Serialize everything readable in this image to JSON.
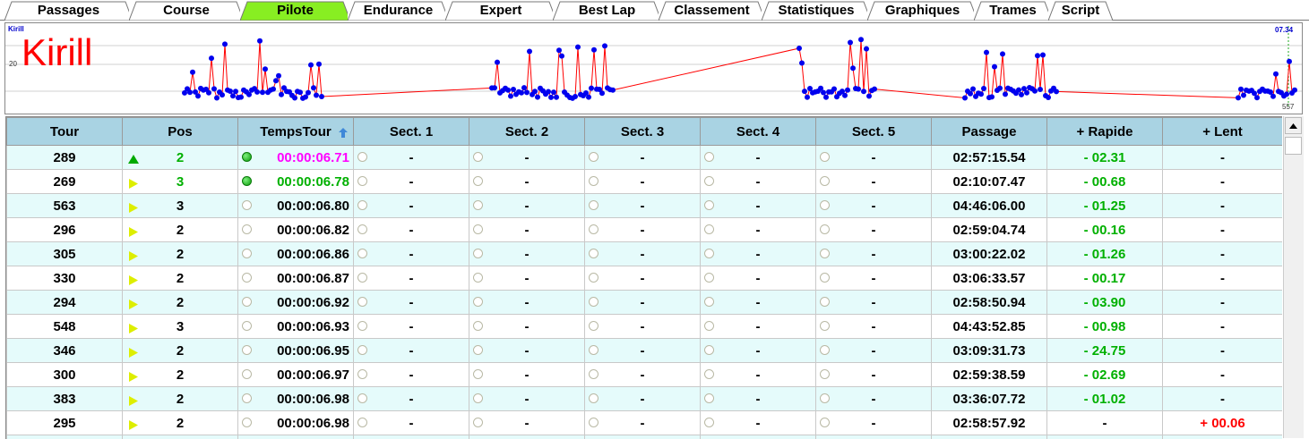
{
  "tabs": [
    {
      "label": "Passages",
      "active": false
    },
    {
      "label": "Course",
      "active": false
    },
    {
      "label": "Pilote",
      "active": true
    },
    {
      "label": "Endurance",
      "active": false
    },
    {
      "label": "Expert",
      "active": false
    },
    {
      "label": "Best Lap",
      "active": false
    },
    {
      "label": "Classement",
      "active": false
    },
    {
      "label": "Statistiques",
      "active": false
    },
    {
      "label": "Graphiques",
      "active": false
    },
    {
      "label": "Trames",
      "active": false
    },
    {
      "label": "Script",
      "active": false
    }
  ],
  "graph": {
    "pilot_small": "Kirill",
    "pilot_large": "Kirill",
    "ytick": "20",
    "top_right": "07.34",
    "bottom_right": "557"
  },
  "table": {
    "headers": [
      "Tour",
      "Pos",
      "TempsTour",
      "Sect. 1",
      "Sect. 2",
      "Sect. 3",
      "Sect. 4",
      "Sect. 5",
      "Passage",
      "+ Rapide",
      "+ Lent"
    ],
    "rows": [
      {
        "tour": "289",
        "pos_icon": "up-triangle-icon",
        "pos": "2",
        "pos_color": "green",
        "dot": "green",
        "temps": "00:00:06.71",
        "temps_color": "magenta",
        "s1": "-",
        "s2": "-",
        "s3": "-",
        "s4": "-",
        "s5": "-",
        "passage": "02:57:15.54",
        "rapide": "- 02.31",
        "rapide_color": "green",
        "lent": "-",
        "lent_color": "black"
      },
      {
        "tour": "269",
        "pos_icon": "right-triangle-icon",
        "pos": "3",
        "pos_color": "green",
        "dot": "green",
        "temps": "00:00:06.78",
        "temps_color": "green",
        "s1": "-",
        "s2": "-",
        "s3": "-",
        "s4": "-",
        "s5": "-",
        "passage": "02:10:07.47",
        "rapide": "- 00.68",
        "rapide_color": "green",
        "lent": "-",
        "lent_color": "black"
      },
      {
        "tour": "563",
        "pos_icon": "right-triangle-icon",
        "pos": "3",
        "pos_color": "black",
        "dot": "empty",
        "temps": "00:00:06.80",
        "temps_color": "black",
        "s1": "-",
        "s2": "-",
        "s3": "-",
        "s4": "-",
        "s5": "-",
        "passage": "04:46:06.00",
        "rapide": "- 01.25",
        "rapide_color": "green",
        "lent": "-",
        "lent_color": "black"
      },
      {
        "tour": "296",
        "pos_icon": "right-triangle-icon",
        "pos": "2",
        "pos_color": "black",
        "dot": "empty",
        "temps": "00:00:06.82",
        "temps_color": "black",
        "s1": "-",
        "s2": "-",
        "s3": "-",
        "s4": "-",
        "s5": "-",
        "passage": "02:59:04.74",
        "rapide": "- 00.16",
        "rapide_color": "green",
        "lent": "-",
        "lent_color": "black"
      },
      {
        "tour": "305",
        "pos_icon": "right-triangle-icon",
        "pos": "2",
        "pos_color": "black",
        "dot": "empty",
        "temps": "00:00:06.86",
        "temps_color": "black",
        "s1": "-",
        "s2": "-",
        "s3": "-",
        "s4": "-",
        "s5": "-",
        "passage": "03:00:22.02",
        "rapide": "- 01.26",
        "rapide_color": "green",
        "lent": "-",
        "lent_color": "black"
      },
      {
        "tour": "330",
        "pos_icon": "right-triangle-icon",
        "pos": "2",
        "pos_color": "black",
        "dot": "empty",
        "temps": "00:00:06.87",
        "temps_color": "black",
        "s1": "-",
        "s2": "-",
        "s3": "-",
        "s4": "-",
        "s5": "-",
        "passage": "03:06:33.57",
        "rapide": "- 00.17",
        "rapide_color": "green",
        "lent": "-",
        "lent_color": "black"
      },
      {
        "tour": "294",
        "pos_icon": "right-triangle-icon",
        "pos": "2",
        "pos_color": "black",
        "dot": "empty",
        "temps": "00:00:06.92",
        "temps_color": "black",
        "s1": "-",
        "s2": "-",
        "s3": "-",
        "s4": "-",
        "s5": "-",
        "passage": "02:58:50.94",
        "rapide": "- 03.90",
        "rapide_color": "green",
        "lent": "-",
        "lent_color": "black"
      },
      {
        "tour": "548",
        "pos_icon": "right-triangle-icon",
        "pos": "3",
        "pos_color": "black",
        "dot": "empty",
        "temps": "00:00:06.93",
        "temps_color": "black",
        "s1": "-",
        "s2": "-",
        "s3": "-",
        "s4": "-",
        "s5": "-",
        "passage": "04:43:52.85",
        "rapide": "- 00.98",
        "rapide_color": "green",
        "lent": "-",
        "lent_color": "black"
      },
      {
        "tour": "346",
        "pos_icon": "right-triangle-icon",
        "pos": "2",
        "pos_color": "black",
        "dot": "empty",
        "temps": "00:00:06.95",
        "temps_color": "black",
        "s1": "-",
        "s2": "-",
        "s3": "-",
        "s4": "-",
        "s5": "-",
        "passage": "03:09:31.73",
        "rapide": "- 24.75",
        "rapide_color": "green",
        "lent": "-",
        "lent_color": "black"
      },
      {
        "tour": "300",
        "pos_icon": "right-triangle-icon",
        "pos": "2",
        "pos_color": "black",
        "dot": "empty",
        "temps": "00:00:06.97",
        "temps_color": "black",
        "s1": "-",
        "s2": "-",
        "s3": "-",
        "s4": "-",
        "s5": "-",
        "passage": "02:59:38.59",
        "rapide": "- 02.69",
        "rapide_color": "green",
        "lent": "-",
        "lent_color": "black"
      },
      {
        "tour": "383",
        "pos_icon": "right-triangle-icon",
        "pos": "2",
        "pos_color": "black",
        "dot": "empty",
        "temps": "00:00:06.98",
        "temps_color": "black",
        "s1": "-",
        "s2": "-",
        "s3": "-",
        "s4": "-",
        "s5": "-",
        "passage": "03:36:07.72",
        "rapide": "- 01.02",
        "rapide_color": "green",
        "lent": "-",
        "lent_color": "black"
      },
      {
        "tour": "295",
        "pos_icon": "right-triangle-icon",
        "pos": "2",
        "pos_color": "black",
        "dot": "empty",
        "temps": "00:00:06.98",
        "temps_color": "black",
        "s1": "-",
        "s2": "-",
        "s3": "-",
        "s4": "-",
        "s5": "-",
        "passage": "02:58:57.92",
        "rapide": "-",
        "rapide_color": "black",
        "lent": "+ 00.06",
        "lent_color": "red"
      },
      {
        "tour": "",
        "pos_icon": "",
        "pos": "",
        "pos_color": "black",
        "dot": "none",
        "temps": "",
        "temps_color": "black",
        "s1": "",
        "s2": "",
        "s3": "",
        "s4": "",
        "s5": "",
        "passage": "",
        "rapide": "",
        "rapide_color": "black",
        "lent": "",
        "lent_color": "black"
      }
    ]
  },
  "colors": {
    "active_tab": "#88ee22",
    "header_bg": "#a9d3e3",
    "row_alt": "#e5fbfb",
    "graph_point": "#0000ee",
    "graph_line": "#ff0000"
  }
}
